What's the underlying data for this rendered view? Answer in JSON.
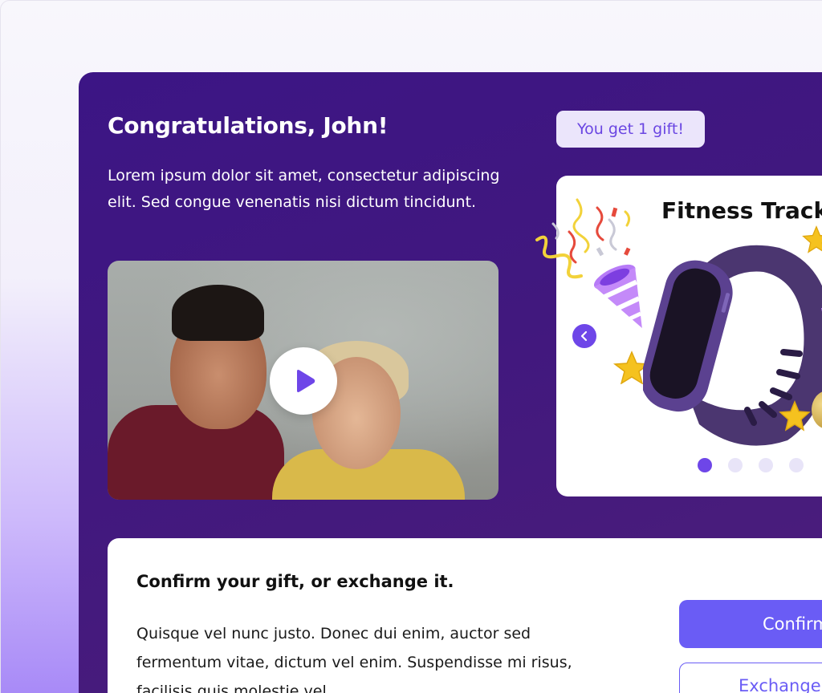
{
  "hero": {
    "title": "Congratulations, John!",
    "description": "Lorem ipsum dolor sit amet, consectetur adipiscing elit. Sed congue venenatis nisi dictum tincidunt.",
    "video": {
      "play_icon": "play-icon"
    }
  },
  "gift": {
    "badge": "You get 1 gift!",
    "title": "Fitness Tracker",
    "prev_icon": "chevron-left-icon",
    "carousel": {
      "total": 4,
      "active": 1
    }
  },
  "confirm": {
    "heading": "Confirm your gift, or exchange it.",
    "body": "Quisque vel nunc justo. Donec dui enim, auctor sed fermentum vitae, dictum vel enim. Suspendisse mi risus, facilisis quis molestie vel.",
    "confirm_label": "Confirm",
    "exchange_label": "Exchange"
  },
  "colors": {
    "hero_bg": "#3c1585",
    "accent": "#6e46e8",
    "button_primary": "#6a5cf5",
    "badge_bg": "#ebe5fb"
  }
}
